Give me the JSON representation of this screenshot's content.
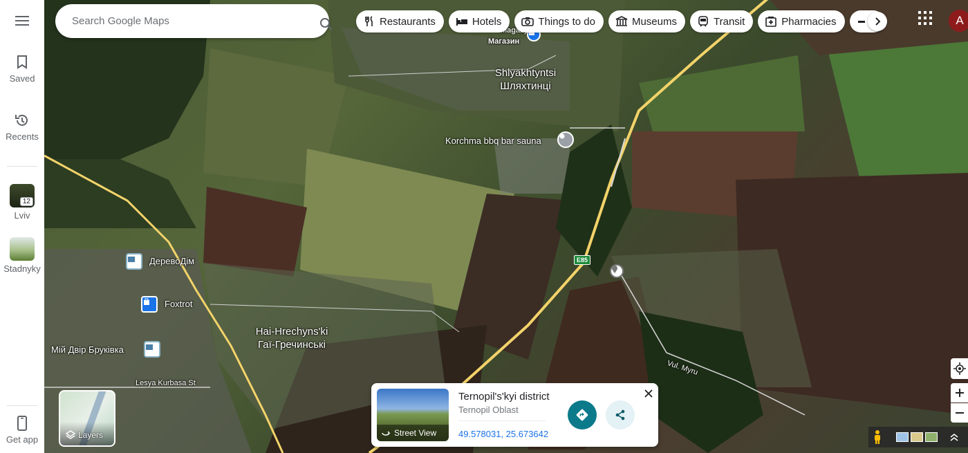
{
  "rail": {
    "saved_label": "Saved",
    "recents_label": "Recents",
    "lviv_label": "Lviv",
    "lviv_badge": "12",
    "stadnyky_label": "Stadnyky",
    "getapp_label": "Get app"
  },
  "search": {
    "placeholder": "Search Google Maps"
  },
  "chips": [
    "Restaurants",
    "Hotels",
    "Things to do",
    "Museums",
    "Transit",
    "Pharmacies"
  ],
  "account_initial": "A",
  "map_labels": {
    "shop_top": "Магазин",
    "shop_top_partial": "Magazyn",
    "village1_latin": "Shlyakhtyntsi",
    "village1_cyr": "Шляхтинці",
    "korchma": "Korchma bbq bar sauna",
    "derevodim": "ДеревоДім",
    "foxtrot": "Foxtrot",
    "village2_latin": "Hai-Hrechyns'ki",
    "village2_cyr": "Гаї-Гречинські",
    "miy_dvir": "Мій Двір Бруківка",
    "lesya": "Lesya Kurbasa St",
    "route": "E85",
    "vul_myru": "Vul. Myru"
  },
  "layers_label": "Layers",
  "card": {
    "title": "Ternopil's'kyi district",
    "subtitle": "Ternopil Oblast",
    "coords": "49.578031, 25.673642",
    "street_view_label": "Street View"
  },
  "colors": {
    "teal": "#0b7a8a",
    "link": "#1a73e8",
    "road": "#f3d36a"
  }
}
